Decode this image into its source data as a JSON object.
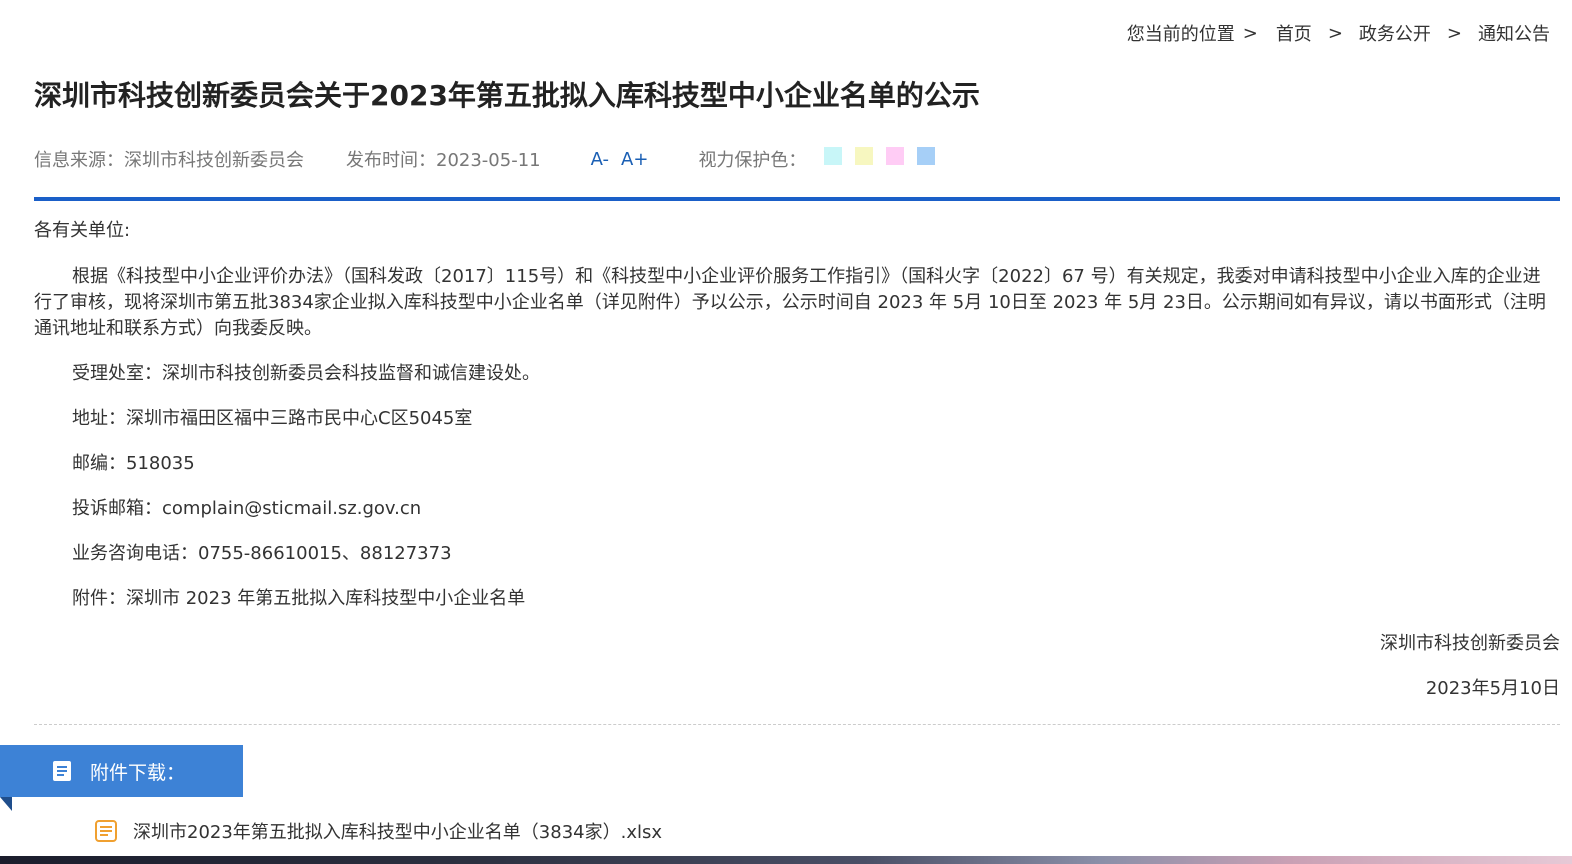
{
  "breadcrumb": {
    "label": "您当前的位置",
    "items": [
      "首页",
      "政务公开",
      "通知公告"
    ],
    "separator": ">"
  },
  "article": {
    "title": "深圳市科技创新委员会关于2023年第五批拟入库科技型中小企业名单的公示",
    "source": "信息来源：深圳市科技创新委员会",
    "publish_time": "发布时间：2023-05-11",
    "font_smaller": "A-",
    "font_larger": "A+",
    "eye_protect_label": "视力保护色：",
    "greeting": "各有关单位:",
    "body": "根据《科技型中小企业评价办法》（国科发政〔2017〕115号）和《科技型中小企业评价服务工作指引》（国科火字〔2022〕67 号）有关规定，我委对申请科技型中小企业入库的企业进行了审核，现将深圳市第五批3834家企业拟入库科技型中小企业名单（详见附件）予以公示，公示时间自 2023 年 5月 10日至 2023 年 5月 23日。公示期间如有异议，请以书面形式（注明通讯地址和联系方式）向我委反映。",
    "office": "受理处室：深圳市科技创新委员会科技监督和诚信建设处。",
    "address": "地址：深圳市福田区福中三路市民中心C区5045室",
    "postcode": "邮编：518035",
    "email": "投诉邮箱：complain@sticmail.sz.gov.cn",
    "phone": "业务咨询电话：0755-86610015、88127373",
    "attachment_note": "附件：深圳市 2023 年第五批拟入库科技型中小企业名单",
    "signature": "深圳市科技创新委员会",
    "date": "2023年5月10日"
  },
  "eye_colors": [
    "#c8f6f8",
    "#f7f7c0",
    "#ffccf5",
    "#a6cff7"
  ],
  "attachments": {
    "header": "附件下载：",
    "files": [
      "深圳市2023年第五批拟入库科技型中小企业名单（3834家）.xlsx"
    ]
  },
  "colors": {
    "accent": "#1a5fc8",
    "banner": "#3d82d6",
    "file_icon": "#f0a030"
  },
  "icons": {
    "banner": "document-icon",
    "file": "file-list-icon"
  }
}
